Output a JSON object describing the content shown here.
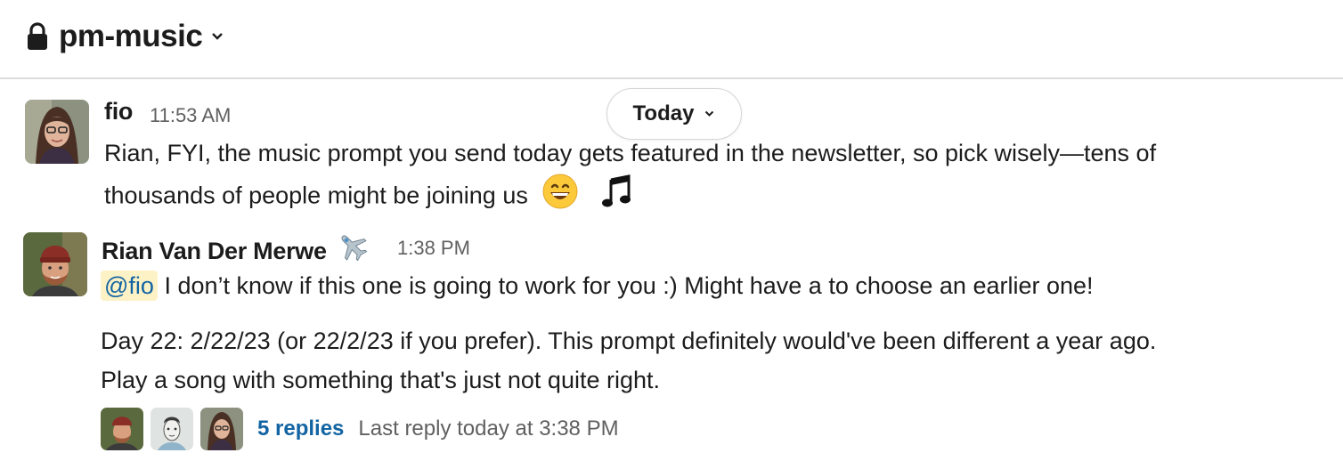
{
  "channel": {
    "name": "pm-music",
    "icon": "lock-icon"
  },
  "date_divider": {
    "label": "Today"
  },
  "messages": [
    {
      "sender": "fio",
      "time": "11:53 AM",
      "lines": [
        "Rian, FYI, the music prompt you send today gets featured in the newsletter, so pick wisely—tens of",
        "thousands of people might be joining us"
      ],
      "emojis": [
        "grinning-face",
        "musical-note"
      ]
    },
    {
      "sender": "Rian Van Der Merwe",
      "status_emoji": "airplane",
      "time": "1:38 PM",
      "mention": "@fio",
      "line1": "I don’t know if this one is going to work for you :) Might have a to choose an earlier one!",
      "line2": "Day 22: 2/22/23 (or 22/2/23 if you prefer). This prompt definitely would've been different a year ago.",
      "line3": "Play a song with something that's just not quite right.",
      "thread": {
        "replies": "5 replies",
        "last_reply": "Last reply today at 3:38 PM"
      }
    }
  ],
  "colors": {
    "link": "#1264a3",
    "mention_bg": "#fdf2c6",
    "muted": "#616061"
  }
}
